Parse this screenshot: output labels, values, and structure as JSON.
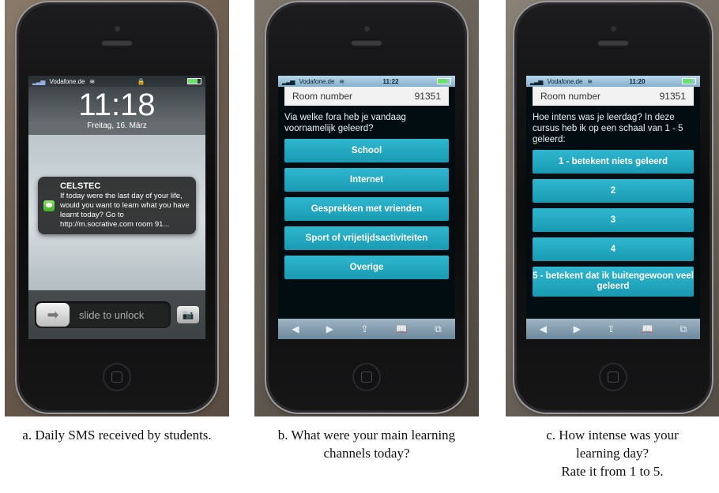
{
  "panel_a": {
    "status": {
      "carrier": "Vodafone.de"
    },
    "time": "11:18",
    "date": "Freitag, 16. März",
    "notification": {
      "title": "CELSTEC",
      "body": "If today were the last day of your life, would you want to learn what you have learnt today? Go to http://m.socrative.com room 91..."
    },
    "unlock_label": "slide to unlock",
    "caption": "a. Daily SMS received by students."
  },
  "panel_b": {
    "status": {
      "carrier": "Vodafone.de",
      "time": "11:22"
    },
    "room_label": "Room number",
    "room_value": "91351",
    "question": "Via welke fora heb je vandaag voornamelijk geleerd?",
    "choices": [
      "School",
      "Internet",
      "Gesprekken met vrienden",
      "Sport of vrijetijdsactiviteiten",
      "Overige"
    ],
    "caption": "b. What were your main learning channels today?"
  },
  "panel_c": {
    "status": {
      "carrier": "Vodafone.de",
      "time": "11:20"
    },
    "room_label": "Room number",
    "room_value": "91351",
    "question": "Hoe intens was je leerdag? In deze cursus heb ik op een schaal van 1 - 5 geleerd:",
    "choices": [
      "1 - betekent niets geleerd",
      "2",
      "3",
      "4",
      "5 - betekent dat ik buitengewoon veel geleerd"
    ],
    "caption_lines": [
      "c. How intense was your",
      "learning day?",
      "Rate it from 1 to 5."
    ]
  }
}
